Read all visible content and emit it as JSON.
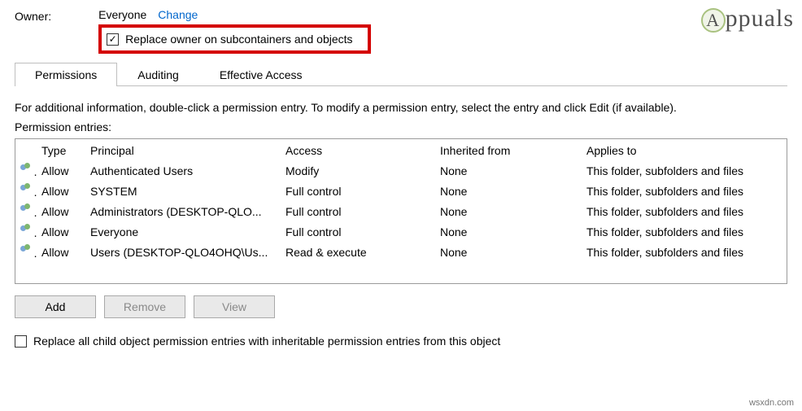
{
  "owner": {
    "label": "Owner:",
    "value": "Everyone",
    "change_link": "Change",
    "replace_checkbox_label": "Replace owner on subcontainers and objects",
    "replace_checked": true
  },
  "tabs": [
    {
      "label": "Permissions",
      "active": true
    },
    {
      "label": "Auditing",
      "active": false
    },
    {
      "label": "Effective Access",
      "active": false
    }
  ],
  "info_text": "For additional information, double-click a permission entry. To modify a permission entry, select the entry and click Edit (if available).",
  "entries_label": "Permission entries:",
  "columns": {
    "type": "Type",
    "principal": "Principal",
    "access": "Access",
    "inherited": "Inherited from",
    "applies": "Applies to"
  },
  "entries": [
    {
      "type": "Allow",
      "principal": "Authenticated Users",
      "access": "Modify",
      "inherited": "None",
      "applies": "This folder, subfolders and files"
    },
    {
      "type": "Allow",
      "principal": "SYSTEM",
      "access": "Full control",
      "inherited": "None",
      "applies": "This folder, subfolders and files"
    },
    {
      "type": "Allow",
      "principal": "Administrators (DESKTOP-QLO...",
      "access": "Full control",
      "inherited": "None",
      "applies": "This folder, subfolders and files"
    },
    {
      "type": "Allow",
      "principal": "Everyone",
      "access": "Full control",
      "inherited": "None",
      "applies": "This folder, subfolders and files"
    },
    {
      "type": "Allow",
      "principal": "Users (DESKTOP-QLO4OHQ\\Us...",
      "access": "Read & execute",
      "inherited": "None",
      "applies": "This folder, subfolders and files"
    }
  ],
  "buttons": {
    "add": "Add",
    "remove": "Remove",
    "view": "View"
  },
  "replace_children_label": "Replace all child object permission entries with inheritable permission entries from this object",
  "replace_children_checked": false,
  "watermark": "Appuals",
  "footer": "wsxdn.com"
}
